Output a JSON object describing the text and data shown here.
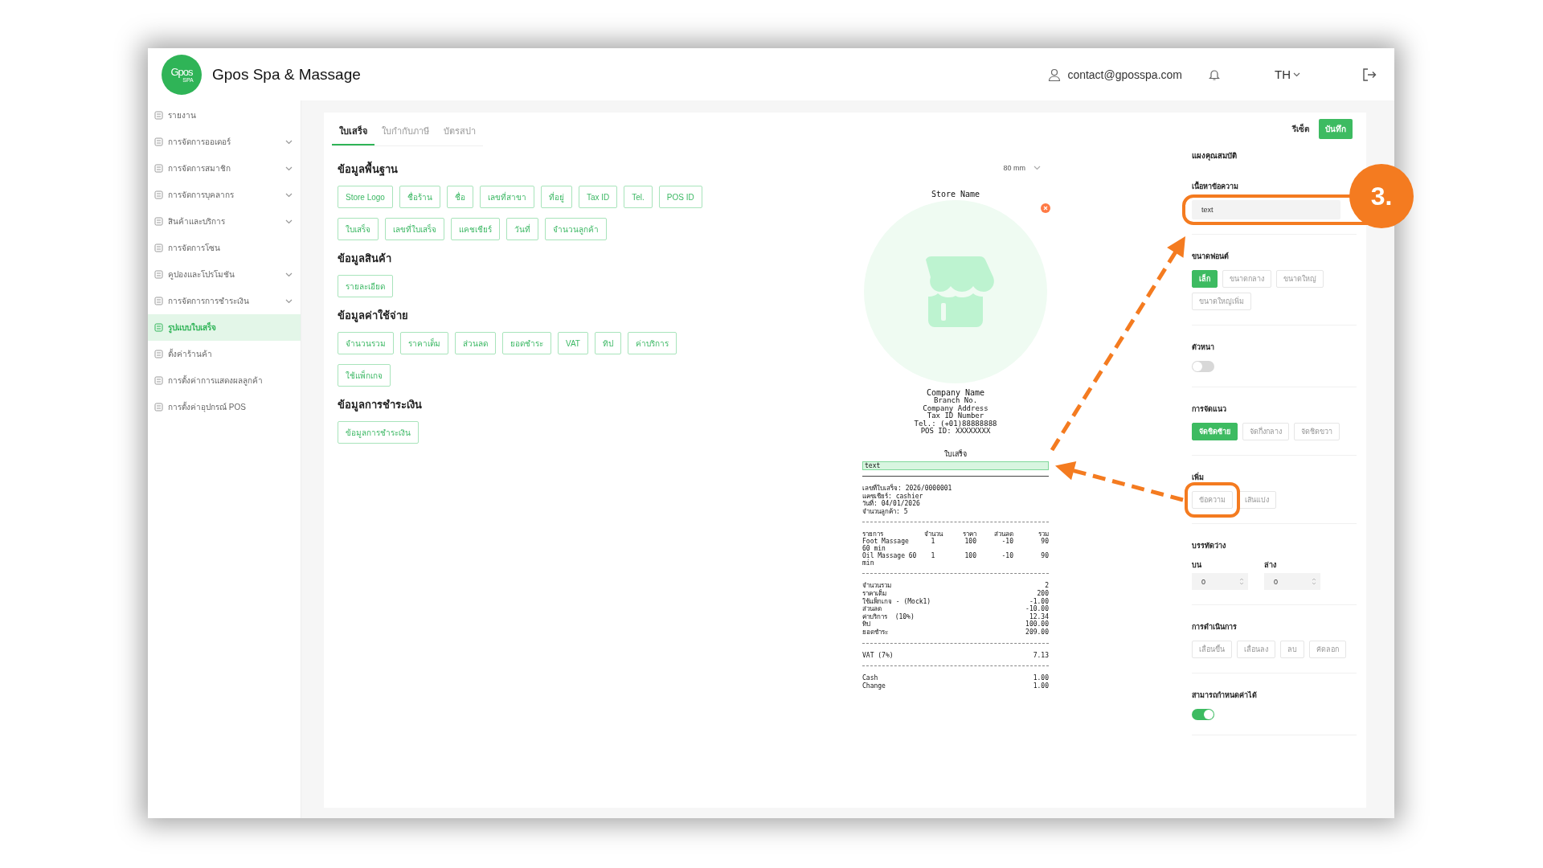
{
  "header": {
    "logo": {
      "mark": "Gpos",
      "sub": "SPA"
    },
    "title": "Gpos Spa & Massage",
    "user_email": "contact@gposspa.com",
    "language": "TH"
  },
  "sidebar": {
    "items": [
      {
        "label": "รายงาน",
        "expandable": false,
        "selected": false
      },
      {
        "label": "การจัดการออเดอร์",
        "expandable": true,
        "selected": false
      },
      {
        "label": "การจัดการสมาชิก",
        "expandable": true,
        "selected": false
      },
      {
        "label": "การจัดการบุคลากร",
        "expandable": true,
        "selected": false
      },
      {
        "label": "สินค้าและบริการ",
        "expandable": true,
        "selected": false
      },
      {
        "label": "การจัดการโซน",
        "expandable": false,
        "selected": false
      },
      {
        "label": "คูปองและโปรโมชัน",
        "expandable": true,
        "selected": false
      },
      {
        "label": "การจัดการการชำระเงิน",
        "expandable": true,
        "selected": false
      },
      {
        "label": "รูปแบบใบเสร็จ",
        "expandable": false,
        "selected": true
      },
      {
        "label": "ตั้งค่าร้านค้า",
        "expandable": false,
        "selected": false
      },
      {
        "label": "การตั้งค่าการแสดงผลลูกค้า",
        "expandable": false,
        "selected": false
      },
      {
        "label": "การตั้งค่าอุปกรณ์ POS",
        "expandable": false,
        "selected": false
      }
    ]
  },
  "tabs": [
    {
      "label": "ใบเสร็จ",
      "selected": true
    },
    {
      "label": "ใบกำกับภาษี",
      "selected": false
    },
    {
      "label": "บัตรสปา",
      "selected": false
    }
  ],
  "actions": {
    "reset": "รีเซ็ต",
    "save": "บันทึก"
  },
  "field_groups": [
    {
      "title": "ข้อมูลพื้นฐาน",
      "fields": [
        "Store Logo",
        "ชื่อร้าน",
        "ชื่อ",
        "เลขที่สาขา",
        "ที่อยู่",
        "Tax ID",
        "Tel.",
        "POS ID",
        "ใบเสร็จ",
        "เลขที่ใบเสร็จ",
        "แคชเชียร์",
        "วันที่",
        "จำนวนลูกค้า"
      ]
    },
    {
      "title": "ข้อมูลสินค้า",
      "fields": [
        "รายละเอียด"
      ]
    },
    {
      "title": "ข้อมูลค่าใช้จ่าย",
      "fields": [
        "จำนวนรวม",
        "ราคาเต็ม",
        "ส่วนลด",
        "ยอดชำระ",
        "VAT",
        "ทิป",
        "ค่าบริการ",
        "ใช้แพ็กเกจ"
      ]
    },
    {
      "title": "ข้อมูลการชำระเงิน",
      "fields": [
        "ข้อมูลการชำระเงิน"
      ]
    }
  ],
  "receipt": {
    "paper_width": "80 mm",
    "store_name": "Store Name",
    "company_name": "Company Name",
    "company_lines": [
      "Branch No.",
      "Company Address",
      "Tax ID Number",
      "Tel.: (+01)88888888",
      "POS ID: XXXXXXXX"
    ],
    "title": "ใบเสร็จ",
    "custom_line": {
      "text": "text",
      "selected": true
    },
    "info_lines": [
      "เลขที่ใบเสร็จ: 2026/0000001",
      "แคชเชียร์: cashier",
      "วันที่: 04/01/2026",
      "จำนวนลูกค้า: 5"
    ],
    "item_columns": [
      "รายการ",
      "จำนวน",
      "ราคา",
      "ส่วนลด",
      "รวม"
    ],
    "items": [
      [
        "Foot Massage 60 min",
        "1",
        "100",
        "-10",
        "90"
      ],
      [
        "Oil Massage 60 min",
        "1",
        "100",
        "-10",
        "90"
      ]
    ],
    "summary": [
      {
        "label": "จำนวนรวม",
        "value": "2"
      },
      {
        "label": "ราคาเต็ม",
        "value": "200"
      },
      {
        "label": "ใช้แพ็กเกจ - (Mock1)",
        "value": "-1.00"
      },
      {
        "label": "ส่วนลด",
        "value": "-10.00"
      },
      {
        "label": "ค่าบริการ  (10%)",
        "value": "12.34"
      },
      {
        "label": "ทิป",
        "value": "100.00"
      },
      {
        "label": "ยอดชำระ",
        "value": "209.00"
      }
    ],
    "vat": [
      {
        "label": "VAT (7%)",
        "value": "7.13"
      }
    ],
    "payments": [
      {
        "label": "Cash",
        "value": "1.00"
      },
      {
        "label": "Change",
        "value": "1.00"
      }
    ]
  },
  "properties": {
    "title": "แผงคุณสมบัติ",
    "sections": [
      {
        "kind": "input",
        "title": "เนื้อหาข้อความ",
        "value": "text"
      },
      {
        "kind": "options",
        "title": "ขนาดฟอนต์",
        "options": [
          {
            "label": "เล็ก",
            "selected": true
          },
          {
            "label": "ขนาดกลาง",
            "selected": false
          },
          {
            "label": "ขนาดใหญ่",
            "selected": false
          },
          {
            "label": "ขนาดใหญ่เพิ่ม",
            "selected": false
          }
        ]
      },
      {
        "kind": "toggle",
        "title": "ตัวหนา",
        "on": false
      },
      {
        "kind": "options",
        "title": "การจัดแนว",
        "options": [
          {
            "label": "จัดชิดซ้าย",
            "selected": true
          },
          {
            "label": "จัดกึ่งกลาง",
            "selected": false
          },
          {
            "label": "จัดชิดขวา",
            "selected": false
          }
        ]
      },
      {
        "kind": "buttons",
        "title": "เพิ่ม",
        "buttons": [
          "ข้อความ",
          "เส้นแบ่ง"
        ]
      },
      {
        "kind": "spinners",
        "title": "บรรทัดว่าง",
        "fields": [
          {
            "label": "บน",
            "value": "0"
          },
          {
            "label": "ล่าง",
            "value": "0"
          }
        ]
      },
      {
        "kind": "buttons",
        "title": "การดำเนินการ",
        "buttons": [
          "เลื่อนขึ้น",
          "เลื่อนลง",
          "ลบ",
          "คัดลอก"
        ]
      },
      {
        "kind": "toggle",
        "title": "สามารถกำหนดค่าได้",
        "on": true
      }
    ]
  },
  "annotation": {
    "step": "3."
  }
}
